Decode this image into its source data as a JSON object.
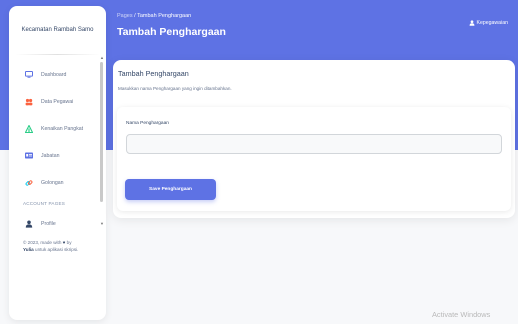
{
  "sidebar": {
    "brand": "Kecamatan Rambah Samo",
    "items": [
      {
        "label": "Dashboard",
        "icon": "monitor-icon"
      },
      {
        "label": "Data Pegawai",
        "icon": "people-icon"
      },
      {
        "label": "Kenaikan Pangkat",
        "icon": "chart-icon"
      },
      {
        "label": "Jabatan",
        "icon": "id-card-icon"
      },
      {
        "label": "Golongan",
        "icon": "link-icon"
      }
    ],
    "section_label": "ACCOUNT PAGES",
    "profile_label": "Profile",
    "footer_prefix": "© 2023, made with",
    "footer_by": "by",
    "footer_author": "Yulia",
    "footer_suffix": "untuk aplikasi skripsi."
  },
  "header": {
    "breadcrumb_parent": "Pages",
    "breadcrumb_current": "Tambah Penghargaan",
    "title": "Tambah Penghargaan",
    "user": "Kepegawaian"
  },
  "card": {
    "title": "Tambah Penghargaan",
    "subtitle": "Masukkan nama Penghargaan yang ingin ditambahkan.",
    "field_label": "Nama Penghargaan",
    "field_value": "",
    "field_placeholder": "",
    "button_label": "Save Penghargaan"
  },
  "watermark": "Activate Windows",
  "colors": {
    "primary": "#5e72e4",
    "heart": "#344767",
    "icon_blue": "#5e72e4",
    "icon_orange": "#fb6340",
    "icon_green": "#2dce89",
    "icon_cyan": "#11cdef"
  }
}
